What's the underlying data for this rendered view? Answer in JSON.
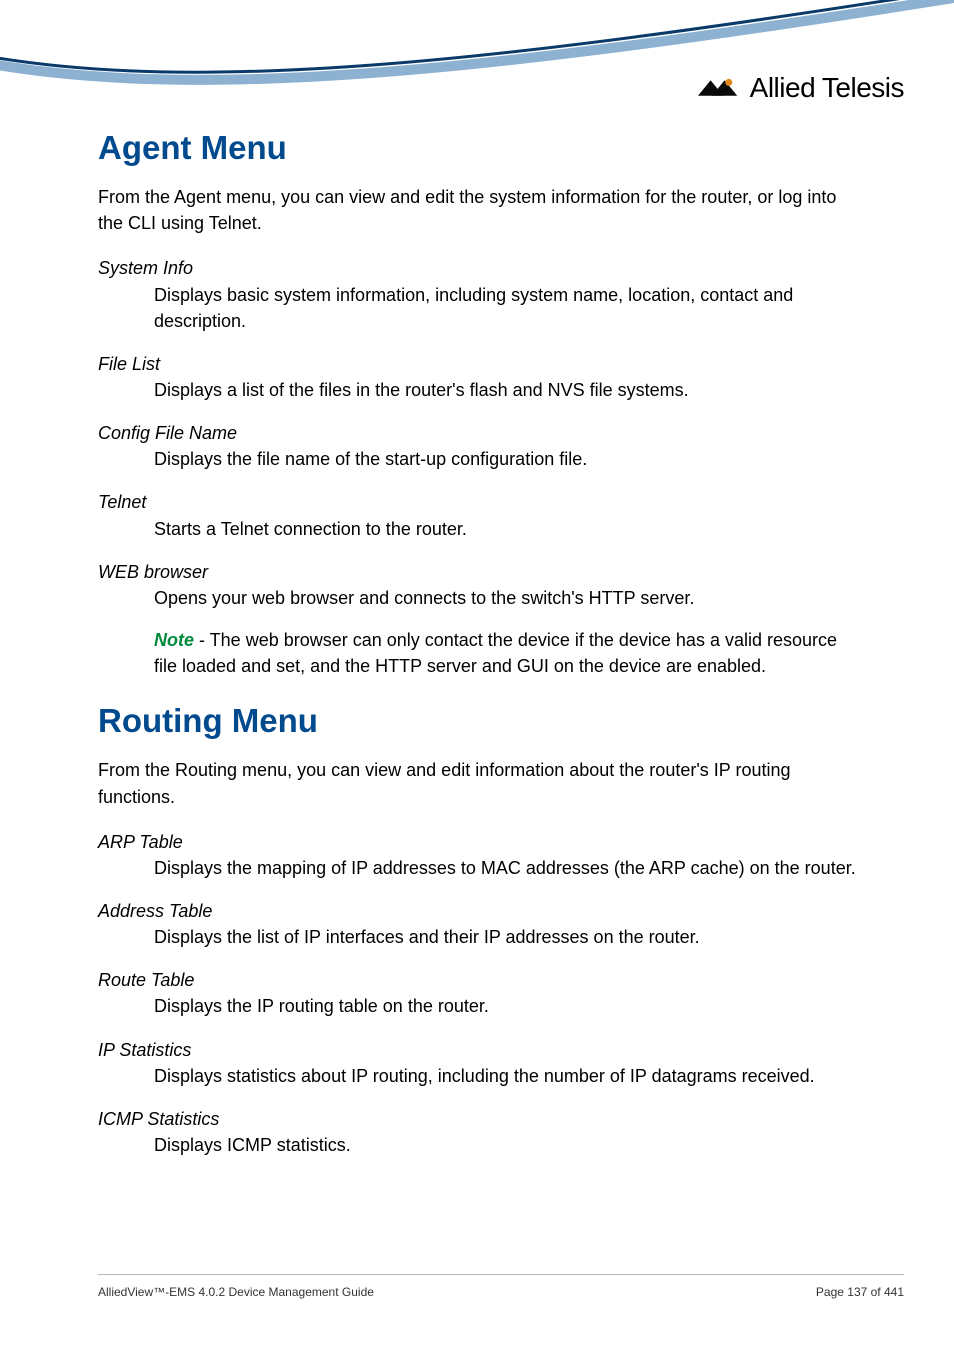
{
  "brand": {
    "logo_name": "allied-telesis-logo",
    "text": "Allied Telesis"
  },
  "sections": [
    {
      "heading": "Agent Menu",
      "intro": "From the Agent menu, you can view and edit the system information for the router, or log into the CLI using Telnet.",
      "items": [
        {
          "label": "System Info",
          "body": "Displays basic system information, including system name, location, contact and description."
        },
        {
          "label": "File List",
          "body": "Displays a list of the files in the router's flash and NVS file systems."
        },
        {
          "label": "Config File Name",
          "body": "Displays the file name of the start-up configuration file."
        },
        {
          "label": "Telnet",
          "body": "Starts a Telnet connection to the router."
        },
        {
          "label": "WEB browser",
          "body": "Opens your web browser and connects to the switch's HTTP server.",
          "note_keyword": "Note",
          "note": " - The web browser can only contact the device if the device has a valid resource file loaded and set, and the HTTP server and GUI on the device are enabled."
        }
      ]
    },
    {
      "heading": "Routing Menu",
      "intro": "From the Routing menu, you can view and edit information about the router's IP routing functions.",
      "items": [
        {
          "label": "ARP Table",
          "body": "Displays the mapping of IP addresses to MAC addresses (the ARP cache) on the router."
        },
        {
          "label": "Address Table",
          "body": "Displays the list of IP interfaces and their IP addresses on the router."
        },
        {
          "label": "Route Table",
          "body": "Displays the IP routing table on the router."
        },
        {
          "label": "IP Statistics",
          "body": "Displays statistics about IP routing, including the number of IP datagrams received."
        },
        {
          "label": "ICMP Statistics",
          "body": "Displays ICMP statistics."
        }
      ]
    }
  ],
  "footer": {
    "left": "AlliedView™-EMS 4.0.2 Device Management Guide",
    "right": "Page 137 of 441"
  }
}
